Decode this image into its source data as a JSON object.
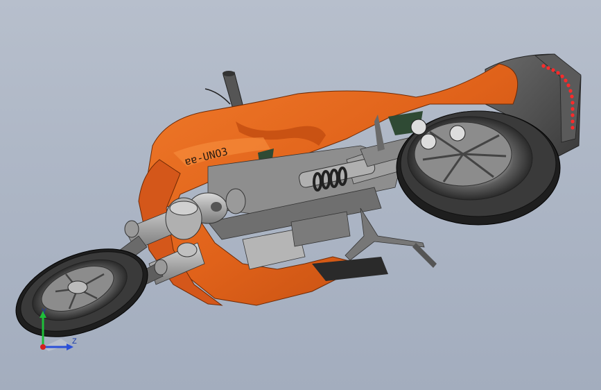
{
  "model": {
    "decal_text": "ɐɐ-UNO3"
  },
  "triad": {
    "y_label": "Y",
    "z_label": "Z",
    "colors": {
      "y_axis": "#1fbf3a",
      "z_axis": "#2a4fd8",
      "x_axis": "#d42020"
    }
  },
  "colors": {
    "background": "#aeb7c6",
    "body_orange": "#e0621a",
    "tire": "#2a2a2a",
    "metal": "#9a9a9a",
    "tail_lights": "#ff2a2a"
  }
}
